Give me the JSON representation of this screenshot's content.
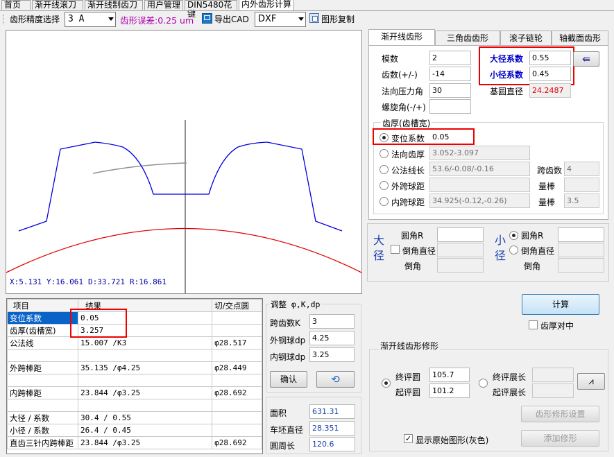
{
  "top_tabs": [
    "首页",
    "渐开线滚刀",
    "渐开线制齿刀",
    "用户管理",
    "DIN5480花键",
    "内外齿形计算"
  ],
  "toolbar": {
    "precision_label": "齿形精度选择",
    "precision_value": "3  A",
    "error_label": "齿形误差:0.25 um",
    "export_label": "导出CAD",
    "export_format": "DXF",
    "copy_label": "图形复制"
  },
  "canvas": {
    "coords": {
      "x": "X:5.131",
      "y": "Y:16.061",
      "d": "D:33.721",
      "r": "R:16.861"
    }
  },
  "right_tabs": [
    "渐开线齿形",
    "三角齿齿形",
    "滚子链轮",
    "轴截面齿形"
  ],
  "params": {
    "module_label": "模数",
    "module_value": "2",
    "teeth_label": "齿数(+/-)",
    "teeth_value": "-14",
    "pressure_label": "法向压力角",
    "pressure_value": "30",
    "helix_label": "螺旋角(-/+)",
    "helix_value": "",
    "major_coef_label": "大径系数",
    "major_coef_value": "0.55",
    "minor_coef_label": "小径系数",
    "minor_coef_value": "0.45",
    "base_dia_label": "基圆直径",
    "base_dia_value": "24.2487"
  },
  "thickness": {
    "group_label": "齿厚(齿槽宽)",
    "shift_label": "变位系数",
    "shift_value": "0.05",
    "normal_thk_label": "法向齿厚",
    "normal_thk_value": "3.052-3.097",
    "span_len_label": "公法线长",
    "span_len_value": "53.6/-0.08/-0.16",
    "span_teeth_label": "跨齿数",
    "span_teeth_value": "4",
    "ext_ball_label": "外跨球距",
    "ext_ball_value": "",
    "ext_rod_label": "量棒",
    "ext_rod_value": "",
    "int_ball_label": "内跨球距",
    "int_ball_value": "34.925(-0.12,-0.26)",
    "int_rod_label": "量棒",
    "int_rod_value": "3.5"
  },
  "chamfer": {
    "major_label": "大径",
    "minor_label": "小径",
    "fillet_label": "圆角R",
    "chamfer_dia_label": "倒角直径",
    "chamfer_label": "倒角"
  },
  "grid": {
    "headers": [
      "项目",
      "结果",
      "切/交点圆"
    ],
    "rows": [
      [
        "变位系数",
        "0.05",
        ""
      ],
      [
        "齿厚(齿槽宽)",
        "3.257",
        ""
      ],
      [
        "公法线",
        "15.007 /K3",
        "φ28.517"
      ],
      [
        "",
        "",
        ""
      ],
      [
        "外跨棒距",
        "35.135 /φ4.25",
        "φ28.449"
      ],
      [
        "",
        "",
        ""
      ],
      [
        "内跨棒距",
        "23.844 /φ3.25",
        "φ28.692"
      ],
      [
        "",
        "",
        ""
      ],
      [
        "大径 / 系数",
        "30.4 / 0.55",
        ""
      ],
      [
        "小径 / 系数",
        "26.4 / 0.45",
        ""
      ],
      [
        "直齿三针内跨棒距",
        "23.844 /φ3.25",
        "φ28.692"
      ]
    ]
  },
  "adjust": {
    "title": "调整 φ,K,dp",
    "span_k_label": "跨齿数K",
    "span_k_value": "3",
    "ext_dp_label": "外钢球dp",
    "ext_dp_value": "4.25",
    "int_dp_label": "内钢球dp",
    "int_dp_value": "3.25",
    "confirm_label": "确认"
  },
  "results": {
    "area_label": "面积",
    "area_value": "631.31",
    "blank_dia_label": "车坯直径",
    "blank_dia_value": "28.351",
    "circumference_label": "圆周长",
    "circumference_value": "120.6"
  },
  "calc": {
    "calc_label": "计算",
    "center_label": "齿厚对中"
  },
  "modify": {
    "title": "渐开线齿形修形",
    "end_circle_label": "终评圆",
    "end_circle_value": "105.7",
    "start_circle_label": "起评圆",
    "start_circle_value": "101.2",
    "end_len_label": "终评展长",
    "start_len_label": "起评展长",
    "settings_label": "齿形修形设置",
    "show_original_label": "显示原始图形(灰色)",
    "add_label": "添加修形"
  }
}
